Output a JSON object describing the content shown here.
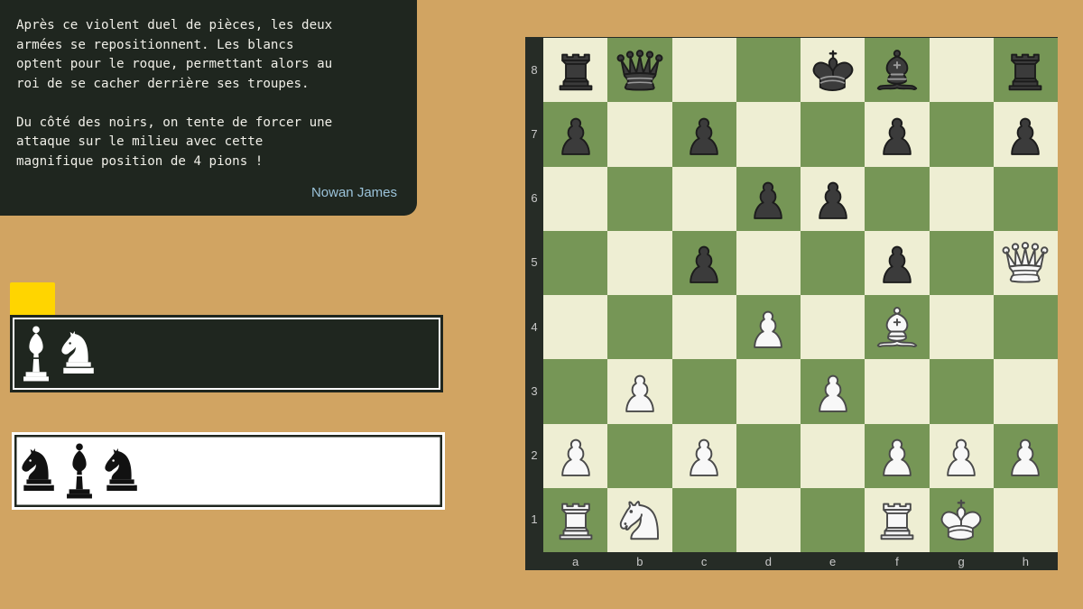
{
  "comment": {
    "text": "Après ce violent duel de pièces, les deux\narmées se repositionnent. Les blancs\noptent pour le roque, permettant alors au\nroi de se cacher derrière ses troupes.\n\nDu côté des noirs, on tente de forcer une\nattaque sur le milieu avec cette\nmagnifique position de 4 pions !",
    "author": "Nowan James"
  },
  "captured_white": [
    "bishop",
    "knight"
  ],
  "captured_black": [
    "knight",
    "bishop",
    "knight"
  ],
  "board": {
    "files": [
      "a",
      "b",
      "c",
      "d",
      "e",
      "f",
      "g",
      "h"
    ],
    "ranks": [
      "8",
      "7",
      "6",
      "5",
      "4",
      "3",
      "2",
      "1"
    ],
    "position": [
      [
        "bR",
        "bQ",
        "",
        "",
        "bK",
        "bB",
        "",
        "bR"
      ],
      [
        "bP",
        "",
        "bP",
        "",
        "",
        "bP",
        "",
        "bP"
      ],
      [
        "",
        "",
        "",
        "bP",
        "bP",
        "",
        "",
        ""
      ],
      [
        "",
        "",
        "bP",
        "",
        "",
        "bP",
        "",
        "wQ"
      ],
      [
        "",
        "",
        "",
        "wP",
        "",
        "wB",
        "",
        ""
      ],
      [
        "",
        "wP",
        "",
        "",
        "wP",
        "",
        "",
        ""
      ],
      [
        "wP",
        "",
        "wP",
        "",
        "",
        "wP",
        "wP",
        "wP"
      ],
      [
        "wR",
        "wN",
        "",
        "",
        "",
        "wR",
        "wK",
        ""
      ]
    ]
  },
  "colors": {
    "background": "#d1a462",
    "light_square": "#eeeed3",
    "dark_square": "#769656",
    "panel": "#1f261f",
    "turn_indicator": "#ffd500",
    "author": "#9bc3da"
  }
}
